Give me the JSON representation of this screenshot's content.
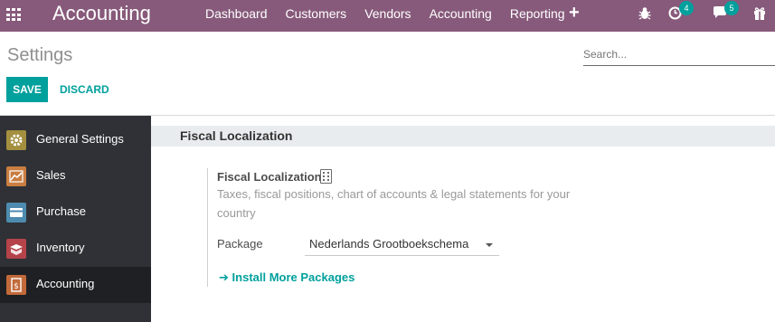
{
  "navbar": {
    "brand": "Accounting",
    "menu": [
      "Dashboard",
      "Customers",
      "Vendors",
      "Accounting",
      "Reporting"
    ],
    "activities_count": "4",
    "messages_count": "5",
    "color": "#875a7b"
  },
  "control_panel": {
    "title": "Settings",
    "search_placeholder": "Search...",
    "save_label": "SAVE",
    "discard_label": "DISCARD",
    "accent": "#00a09d"
  },
  "sidebar": {
    "items": [
      {
        "label": "General Settings",
        "icon": "gear-icon",
        "color": "#a38f3f"
      },
      {
        "label": "Sales",
        "icon": "sales-chart-icon",
        "color": "#c97d41"
      },
      {
        "label": "Purchase",
        "icon": "purchase-card-icon",
        "color": "#4d8bb0"
      },
      {
        "label": "Inventory",
        "icon": "inventory-box-icon",
        "color": "#b5434a"
      },
      {
        "label": "Accounting",
        "icon": "accounting-invoice-icon",
        "color": "#c26a3a"
      }
    ],
    "active_index": 4
  },
  "main": {
    "section_title": "Fiscal Localization",
    "setting_title": "Fiscal Localization",
    "setting_icon": "building-icon",
    "description": "Taxes, fiscal positions, chart of accounts & legal statements for your country",
    "package_label": "Package",
    "package_value": "Nederlands Grootboekschema",
    "install_link": "Install More Packages"
  }
}
